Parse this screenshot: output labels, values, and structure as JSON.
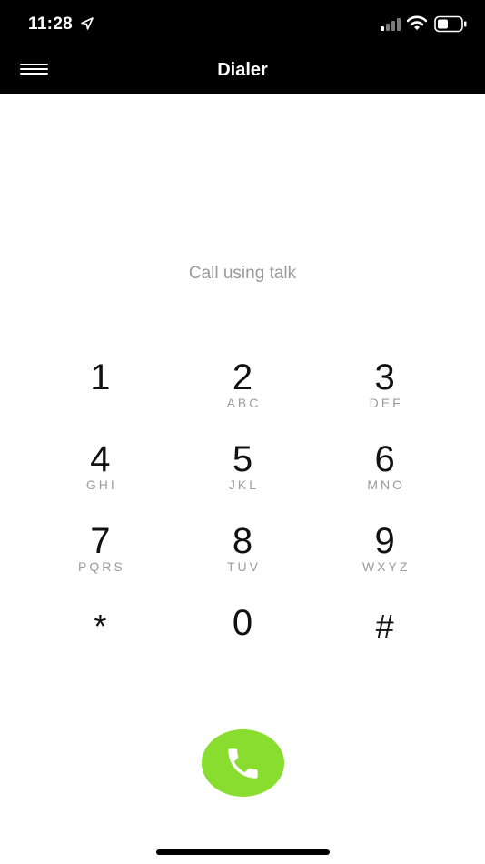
{
  "status_bar": {
    "time": "11:28",
    "icons": [
      "location-arrow-icon",
      "cellular-signal-icon",
      "wifi-icon",
      "battery-icon"
    ]
  },
  "nav_bar": {
    "title": "Dialer",
    "menu_icon": "hamburger-menu-icon"
  },
  "subtitle": "Call using talk",
  "keypad": {
    "keys": [
      {
        "digit": "1",
        "letters": ""
      },
      {
        "digit": "2",
        "letters": "ABC"
      },
      {
        "digit": "3",
        "letters": "DEF"
      },
      {
        "digit": "4",
        "letters": "GHI"
      },
      {
        "digit": "5",
        "letters": "JKL"
      },
      {
        "digit": "6",
        "letters": "MNO"
      },
      {
        "digit": "7",
        "letters": "PQRS"
      },
      {
        "digit": "8",
        "letters": "TUV"
      },
      {
        "digit": "9",
        "letters": "WXYZ"
      },
      {
        "digit": "*",
        "letters": ""
      },
      {
        "digit": "0",
        "letters": ""
      },
      {
        "digit": "#",
        "letters": ""
      }
    ]
  },
  "call_button": {
    "icon": "phone-icon",
    "color": "#88dd2f"
  },
  "colors": {
    "header_bg": "#000000",
    "subtitle_text": "#9a9a9a",
    "letters_text": "#9b9b9b"
  }
}
